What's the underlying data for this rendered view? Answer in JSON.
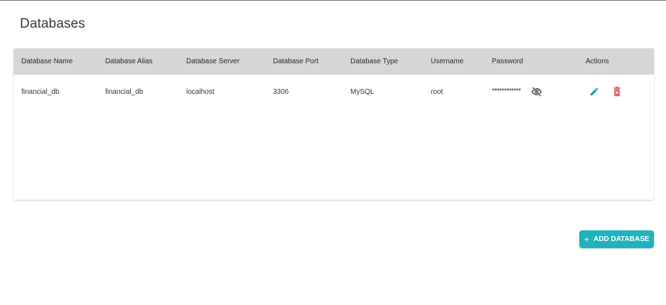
{
  "page": {
    "title": "Databases"
  },
  "table": {
    "columns": [
      "Database Name",
      "Database Alias",
      "Database Server",
      "Database Port",
      "Database Type",
      "Username",
      "Password",
      "Actions"
    ],
    "rows": [
      {
        "name": "financial_db",
        "alias": "financial_db",
        "server": "localhost",
        "port": "3306",
        "type": "MySQL",
        "username": "root",
        "password_mask": "************",
        "icons": {
          "visibility": "eye-off-icon",
          "edit": "pencil-icon",
          "delete": "trash-icon"
        }
      }
    ]
  },
  "add_button": {
    "icon": "+",
    "label": "ADD DATABASE"
  },
  "colors": {
    "header_bg": "#d6d6d6",
    "accent": "#1fb3be",
    "edit_icon": "#159aa6",
    "delete_icon": "#e15a5a"
  }
}
